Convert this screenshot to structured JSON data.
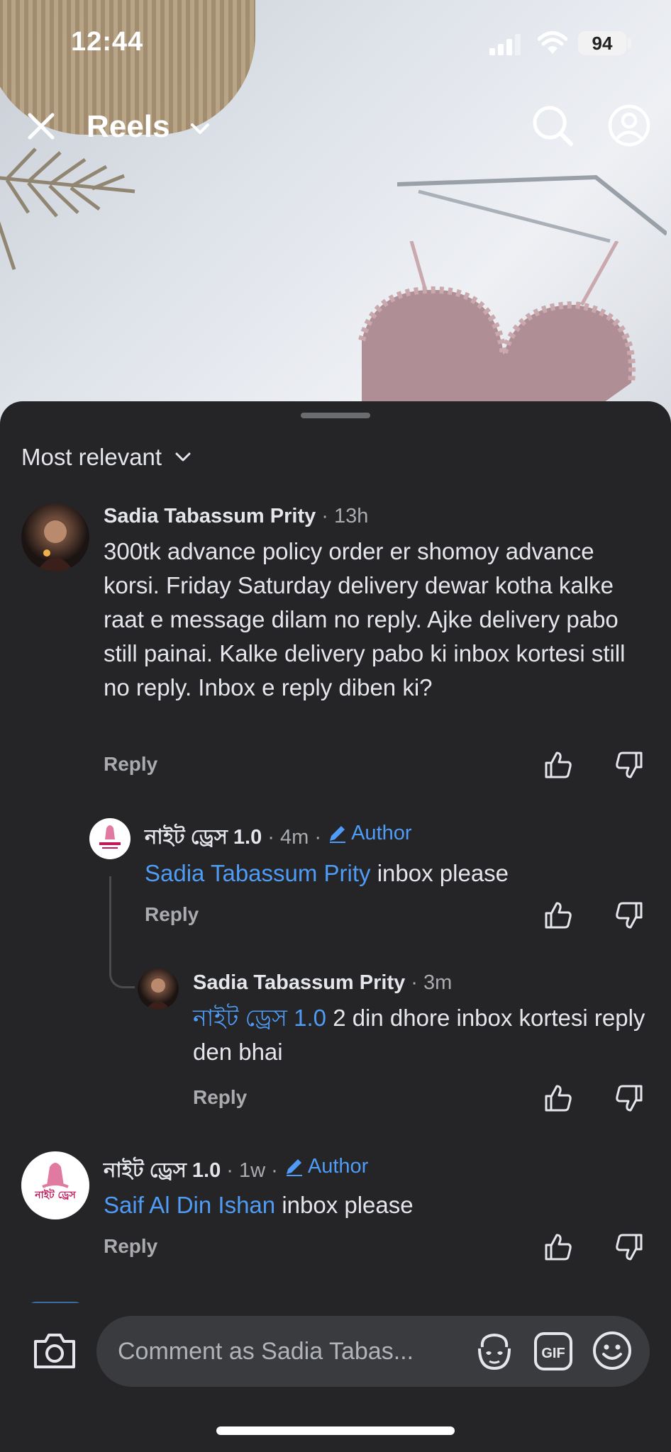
{
  "status_bar": {
    "time": "12:44",
    "battery": "94"
  },
  "top_bar": {
    "title": "Reels"
  },
  "comments": {
    "sort_label": "Most relevant",
    "items": [
      {
        "name": "Sadia Tabassum Prity",
        "time": "13h",
        "text": "300tk advance policy order er shomoy advance korsi. Friday Saturday delivery dewar kotha kalke raat e message dilam no reply. Ajke delivery pabo still painai. Kalke delivery pabo ki inbox kortesi still no reply. Inbox e reply diben ki?",
        "reply_label": "Reply",
        "replies": [
          {
            "name": "নাইট ড্রেস 1.0",
            "time": "4m",
            "badge": "Author",
            "mention": "Sadia Tabassum Prity",
            "text": "inbox please",
            "reply_label": "Reply"
          },
          {
            "name": "Sadia Tabassum Prity",
            "time": "3m",
            "mention": "নাইট ড্রেস 1.0",
            "text": "2 din dhore inbox kortesi reply den bhai",
            "reply_label": "Reply"
          }
        ]
      },
      {
        "name": "নাইট ড্রেস 1.0",
        "time": "1w",
        "badge": "Author",
        "mention": "Saif Al Din Ishan",
        "text": "inbox please",
        "reply_label": "Reply",
        "avatar_logo_text": "নাইট ড্রেস"
      }
    ]
  },
  "composer": {
    "placeholder": "Comment as Sadia Tabas..."
  },
  "colors": {
    "sheet": "#252527",
    "link": "#4e9cf5",
    "muted": "#a9abaf",
    "text": "#e4e6eb"
  }
}
